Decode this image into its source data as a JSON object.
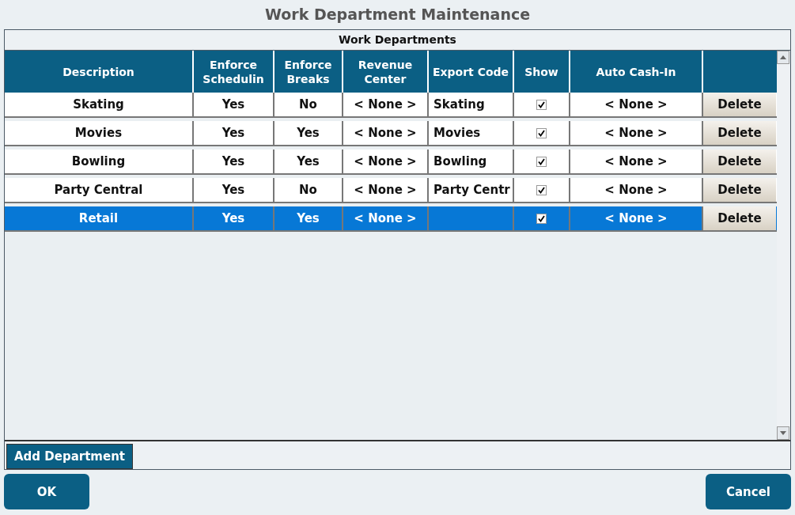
{
  "window": {
    "title": "Work Department Maintenance"
  },
  "table": {
    "caption": "Work Departments",
    "columns": [
      "Description",
      "Enforce Schedulin",
      "Enforce Breaks",
      "Revenue Center",
      "Export Code",
      "Show",
      "Auto Cash-In"
    ],
    "rows": [
      {
        "description": "Skating",
        "enforce_scheduling": "Yes",
        "enforce_breaks": "No",
        "revenue_center": "< None >",
        "export_code": "Skating",
        "show": true,
        "auto_cash_in": "< None >",
        "delete": "Delete",
        "selected": false
      },
      {
        "description": "Movies",
        "enforce_scheduling": "Yes",
        "enforce_breaks": "Yes",
        "revenue_center": "< None >",
        "export_code": "Movies",
        "show": true,
        "auto_cash_in": "< None >",
        "delete": "Delete",
        "selected": false
      },
      {
        "description": "Bowling",
        "enforce_scheduling": "Yes",
        "enforce_breaks": "Yes",
        "revenue_center": "< None >",
        "export_code": "Bowling",
        "show": true,
        "auto_cash_in": "< None >",
        "delete": "Delete",
        "selected": false
      },
      {
        "description": "Party Central",
        "enforce_scheduling": "Yes",
        "enforce_breaks": "No",
        "revenue_center": "< None >",
        "export_code": "Party Centr",
        "show": true,
        "auto_cash_in": "< None >",
        "delete": "Delete",
        "selected": false
      },
      {
        "description": "Retail",
        "enforce_scheduling": "Yes",
        "enforce_breaks": "Yes",
        "revenue_center": "< None >",
        "export_code": "",
        "show": true,
        "auto_cash_in": "< None >",
        "delete": "Delete",
        "selected": true
      }
    ]
  },
  "add_button": "Add Department",
  "ok_button": "OK",
  "cancel_button": "Cancel"
}
